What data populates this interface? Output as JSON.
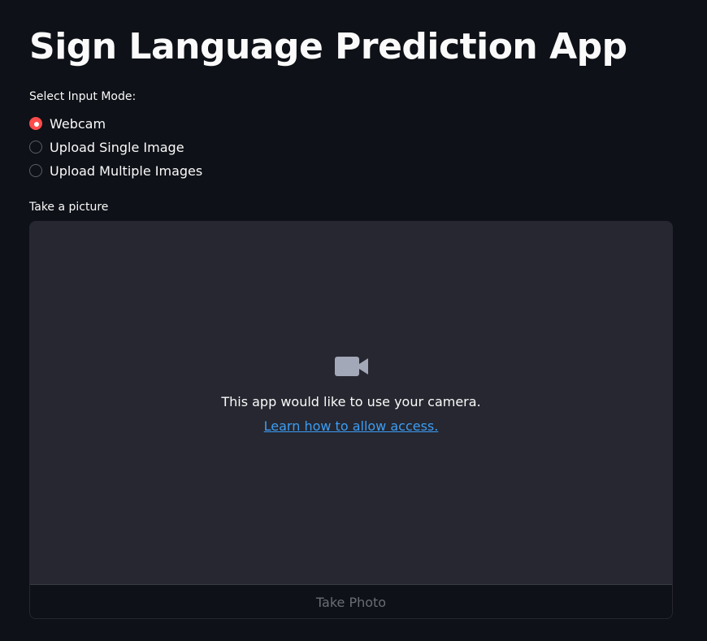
{
  "page": {
    "title": "Sign Language Prediction App"
  },
  "input_mode": {
    "label": "Select Input Mode:",
    "options": [
      {
        "label": "Webcam",
        "selected": true
      },
      {
        "label": "Upload Single Image",
        "selected": false
      },
      {
        "label": "Upload Multiple Images",
        "selected": false
      }
    ]
  },
  "camera": {
    "label": "Take a picture",
    "icon": "video-camera-icon",
    "message": "This app would like to use your camera.",
    "link_text": "Learn how to allow access.",
    "button_label": "Take Photo"
  },
  "colors": {
    "background": "#0e1117",
    "accent": "#ff4b4b",
    "link": "#3d9df3",
    "camera_panel": "#262730",
    "icon": "#a3a8b8"
  }
}
